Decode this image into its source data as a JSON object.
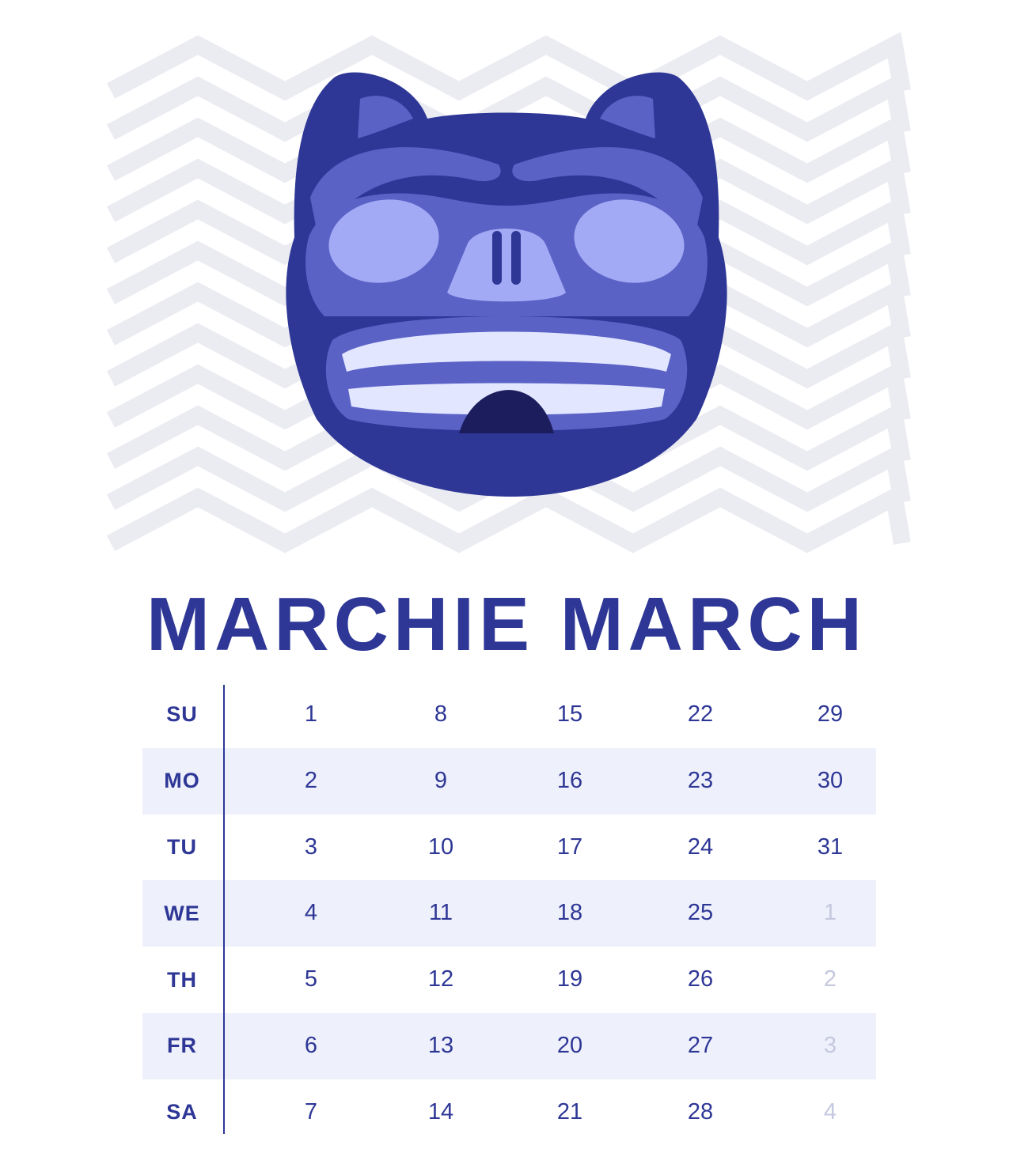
{
  "title": "MARCHIE MARCH",
  "colors": {
    "accent": "#2e3796",
    "zigzag": "#ebebf2",
    "row_shade": "#eef0fb",
    "overflow_day": "#c5c8de",
    "mask_dark": "#2e3796",
    "mask_mid": "#5a62c6",
    "mask_light": "#a3aaf5",
    "teeth": "#e2e6ff",
    "mouth": "#1c1d5c"
  },
  "illustration": {
    "icon": "bear-mask-icon",
    "background": "zigzag-pattern"
  },
  "calendar": {
    "days": [
      {
        "label": "SU",
        "dates": [
          {
            "n": "1"
          },
          {
            "n": "8"
          },
          {
            "n": "15"
          },
          {
            "n": "22"
          },
          {
            "n": "29"
          }
        ]
      },
      {
        "label": "MO",
        "dates": [
          {
            "n": "2"
          },
          {
            "n": "9"
          },
          {
            "n": "16"
          },
          {
            "n": "23"
          },
          {
            "n": "30"
          }
        ]
      },
      {
        "label": "TU",
        "dates": [
          {
            "n": "3"
          },
          {
            "n": "10"
          },
          {
            "n": "17"
          },
          {
            "n": "24"
          },
          {
            "n": "31"
          }
        ]
      },
      {
        "label": "WE",
        "dates": [
          {
            "n": "4"
          },
          {
            "n": "11"
          },
          {
            "n": "18"
          },
          {
            "n": "25"
          },
          {
            "n": "1",
            "next_month": true
          }
        ]
      },
      {
        "label": "TH",
        "dates": [
          {
            "n": "5"
          },
          {
            "n": "12"
          },
          {
            "n": "19"
          },
          {
            "n": "26"
          },
          {
            "n": "2",
            "next_month": true
          }
        ]
      },
      {
        "label": "FR",
        "dates": [
          {
            "n": "6"
          },
          {
            "n": "13"
          },
          {
            "n": "20"
          },
          {
            "n": "27"
          },
          {
            "n": "3",
            "next_month": true
          }
        ]
      },
      {
        "label": "SA",
        "dates": [
          {
            "n": "7"
          },
          {
            "n": "14"
          },
          {
            "n": "21"
          },
          {
            "n": "28"
          },
          {
            "n": "4",
            "next_month": true
          }
        ]
      }
    ]
  }
}
